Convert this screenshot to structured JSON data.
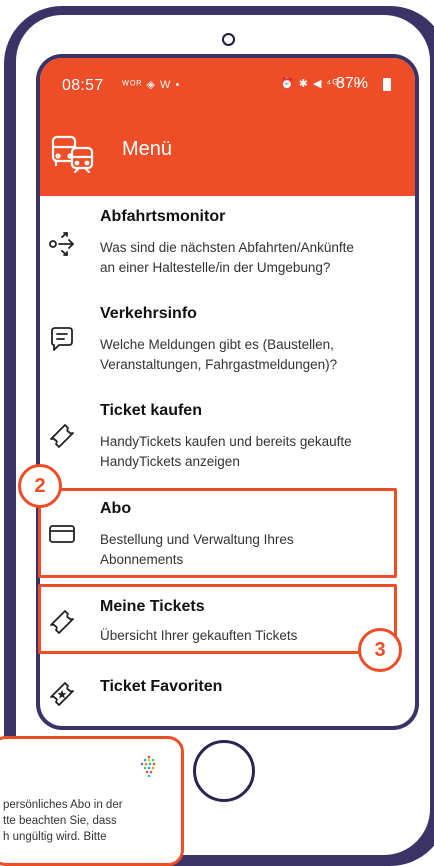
{
  "statusbar": {
    "time": "08:57",
    "left_icons": "ᵂᴼᴿ ◈ W •",
    "right_icons": "⏰ ✱ ◀ ⁴ᴳ⁺ .ıl",
    "battery": "87%"
  },
  "appbar": {
    "title": "Menü",
    "icon": "bus-tram-icon"
  },
  "menu": [
    {
      "title": "Abfahrtsmonitor",
      "desc1": "Was sind die nächsten Abfahrten/Ankünfte",
      "desc2": "an einer Haltestelle/in der Umgebung?",
      "icon": "departures-icon"
    },
    {
      "title": "Verkehrsinfo",
      "desc1": "Welche Meldungen gibt es (Baustellen,",
      "desc2": "Veranstaltungen, Fahrgastmeldungen)?",
      "icon": "message-icon"
    },
    {
      "title": "Ticket kaufen",
      "desc1": "HandyTickets kaufen und bereits gekaufte",
      "desc2": "HandyTickets anzeigen",
      "icon": "ticket-icon"
    },
    {
      "title": "Abo",
      "desc1": "Bestellung und Verwaltung Ihres",
      "desc2": "Abonnements",
      "icon": "card-icon"
    },
    {
      "title": "Meine Tickets",
      "desc1": "Übersicht Ihrer gekauften Tickets",
      "desc2": "",
      "icon": "ticket-icon"
    },
    {
      "title": "Ticket Favoriten",
      "desc1": "",
      "desc2": "",
      "icon": "favorite-ticket-icon"
    }
  ],
  "badges": {
    "abo": "2",
    "meine_tickets": "3"
  },
  "tooltip": {
    "line1": "persönliches Abo in der",
    "line2": "tte beachten Sie, dass",
    "line3": "h ungültig wird. Bitte"
  },
  "colors": {
    "accent": "#ee4e27",
    "frame": "#3b3266"
  }
}
